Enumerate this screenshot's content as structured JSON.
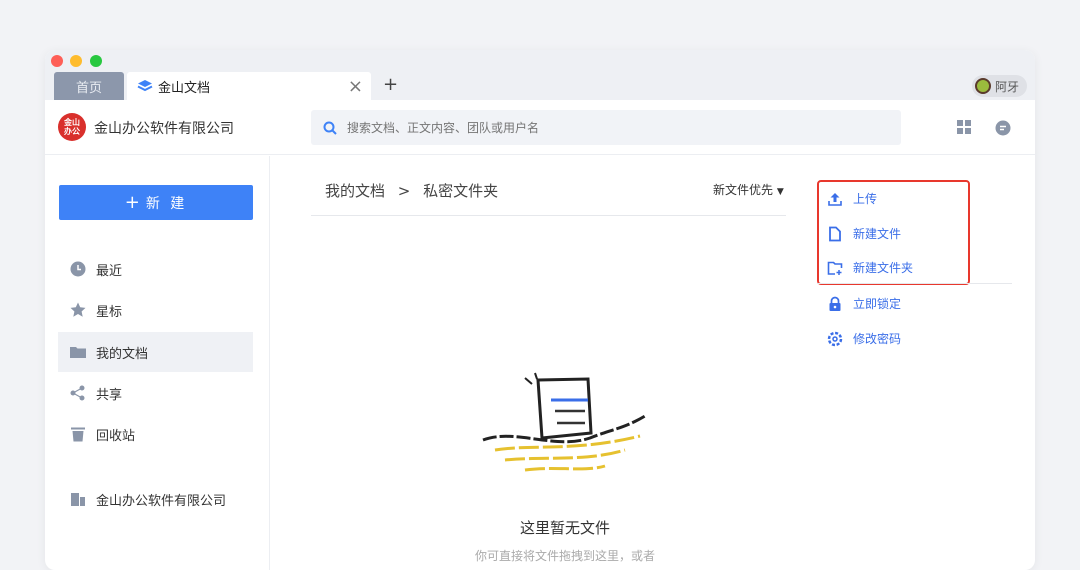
{
  "tabs": {
    "home": "首页",
    "doc": "金山文档"
  },
  "user": {
    "name": "阿牙"
  },
  "header": {
    "company": "金山办公软件有限公司",
    "logo_text": "金山办公",
    "search_placeholder": "搜索文档、正文内容、团队或用户名"
  },
  "sidebar": {
    "new_label": "新 建",
    "items": [
      {
        "label": "最近"
      },
      {
        "label": "星标"
      },
      {
        "label": "我的文档"
      },
      {
        "label": "共享"
      },
      {
        "label": "回收站"
      }
    ],
    "team": "金山办公软件有限公司"
  },
  "main": {
    "breadcrumb": [
      "我的文档",
      "私密文件夹"
    ],
    "sep": ">",
    "sort": "新文件优先",
    "empty_title": "这里暂无文件",
    "empty_sub": "你可直接将文件拖拽到这里，或者"
  },
  "menu": {
    "items": [
      {
        "label": "上传"
      },
      {
        "label": "新建文件"
      },
      {
        "label": "新建文件夹"
      },
      {
        "label": "立即锁定"
      },
      {
        "label": "修改密码"
      }
    ]
  },
  "colors": {
    "accent": "#3e82f7",
    "highlight": "#e8382d"
  }
}
